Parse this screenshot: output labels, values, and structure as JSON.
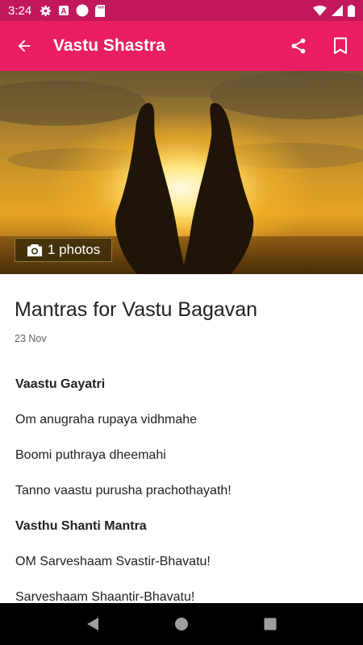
{
  "status_bar": {
    "time": "3:24",
    "left_icons": [
      "gear-icon",
      "a-badge-icon",
      "circle-icon",
      "sd-card-icon"
    ],
    "right_icons": [
      "wifi-icon",
      "signal-icon",
      "battery-icon"
    ]
  },
  "app_bar": {
    "title": "Vastu Shastra",
    "actions": [
      "share-icon",
      "bookmark-icon"
    ],
    "color": "#e91e63",
    "status_color": "#c2185b"
  },
  "hero": {
    "photo_count_label": "1 photos",
    "icon": "camera-icon"
  },
  "article": {
    "title": "Mantras for Vastu Bagavan",
    "date": "23 Nov",
    "lines": [
      {
        "text": "Vaastu Gayatri",
        "bold": true
      },
      {
        "text": "Om anugraha rupaya vidhmahe",
        "bold": false
      },
      {
        "text": "Boomi puthraya dheemahi",
        "bold": false
      },
      {
        "text": "Tanno vaastu purusha prachothayath!",
        "bold": false
      },
      {
        "text": "Vasthu Shanti Mantra",
        "bold": true
      },
      {
        "text": "OM Sarveshaam Svastir-Bhavatu!",
        "bold": false
      },
      {
        "text": "Sarveshaam Shaantir-Bhavatu!",
        "bold": false
      }
    ]
  },
  "nav_bar": {
    "buttons": [
      "back-triangle-icon",
      "home-circle-icon",
      "recents-square-icon"
    ]
  }
}
